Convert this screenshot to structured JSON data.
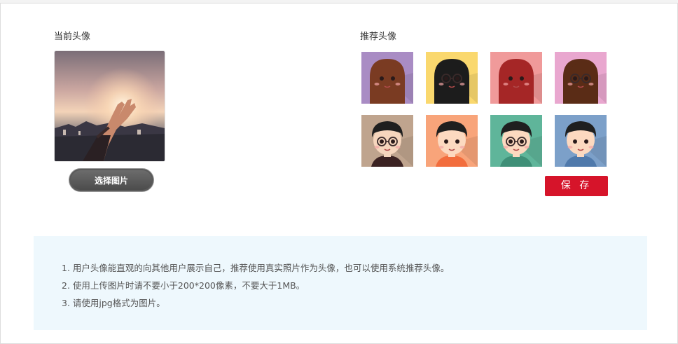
{
  "current": {
    "label": "当前头像",
    "choose_button": "选择图片"
  },
  "recommended": {
    "label": "推荐头像",
    "avatars": [
      {
        "bg": "#a98cc4",
        "hair": "#7a3b22",
        "skin": "#fde4d0",
        "shirt": "#f2a6b4"
      },
      {
        "bg": "#fad86e",
        "hair": "#1c1c1c",
        "skin": "#fde4d0",
        "shirt": "#e6a024"
      },
      {
        "bg": "#f09a9a",
        "hair": "#a52626",
        "skin": "#fde4d0",
        "shirt": "#d94848"
      },
      {
        "bg": "#e9a7cf",
        "hair": "#5a2c16",
        "skin": "#fde4d0",
        "shirt": "#ec6aa8"
      },
      {
        "bg": "#bfa48e",
        "hair": "#1f1f1f",
        "skin": "#f6d6bd",
        "shirt": "#3b2222"
      },
      {
        "bg": "#f8a47a",
        "hair": "#1f1f1f",
        "skin": "#fcd9c0",
        "shirt": "#f26d3d"
      },
      {
        "bg": "#5fb59a",
        "hair": "#1f1f1f",
        "skin": "#fcd9c0",
        "shirt": "#3f8f77"
      },
      {
        "bg": "#7ca0c9",
        "hair": "#1f1f1f",
        "skin": "#fcd9c0",
        "shirt": "#4f79ab"
      }
    ],
    "save_button": "保 存"
  },
  "notes": [
    "1. 用户头像能直观的向其他用户展示自己，推荐使用真实照片作为头像，也可以使用系统推荐头像。",
    "2. 使用上传图片时请不要小于200*200像素，不要大于1MB。",
    "3. 请使用jpg格式为图片。"
  ],
  "colors": {
    "save": "#d6142a",
    "notes_bg": "#eef8fd"
  }
}
